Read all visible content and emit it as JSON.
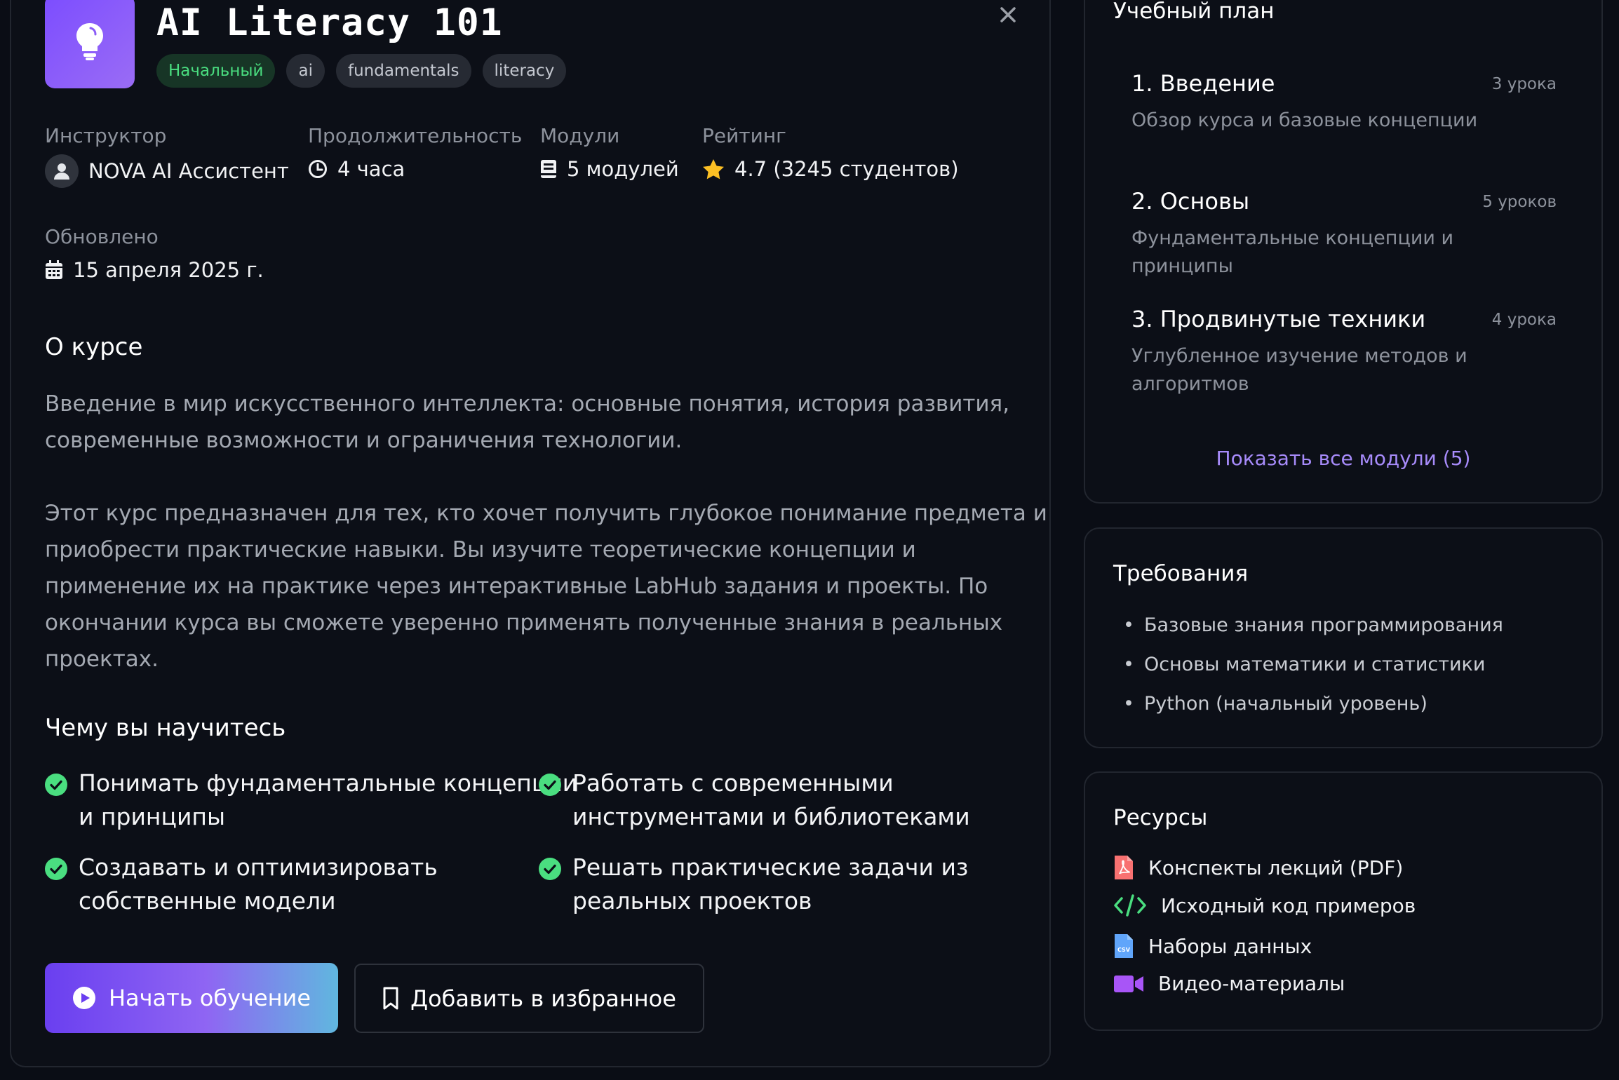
{
  "course": {
    "title": "AI Literacy 101",
    "tags": [
      "Начальный",
      "ai",
      "fundamentals",
      "literacy"
    ]
  },
  "meta": {
    "instructor_label": "Инструктор",
    "instructor_value": "NOVA AI Ассистент",
    "duration_label": "Продолжительность",
    "duration_value": "4 часа",
    "modules_label": "Модули",
    "modules_value": "5 модулей",
    "rating_label": "Рейтинг",
    "rating_value": "4.7 (3245 студентов)",
    "updated_label": "Обновлено",
    "updated_value": "15 апреля 2025 г."
  },
  "about": {
    "title": "О курсе",
    "p1_line1": "Введение в мир искусственного интеллекта: основные понятия, история развития,",
    "p1_line2": "современные возможности и ограничения технологии.",
    "p2_line1": "Этот курс предназначен для тех, кто хочет получить глубокое понимание предмета и",
    "p2_line2": "приобрести практические навыки. Вы изучите теоретические концепции и",
    "p2_line3": "применение их на практике через интерактивные LabHub задания и проекты. По",
    "p2_line4": "окончании курса вы сможете уверенно применять полученные знания в реальных",
    "p2_line5": "проектах."
  },
  "learn": {
    "title": "Чему вы научитесь",
    "items": [
      {
        "line1": "Понимать фундаментальные концепции",
        "line2": "и принципы"
      },
      {
        "line1": "Работать с современными",
        "line2": "инструментами и библиотеками"
      },
      {
        "line1": "Создавать и оптимизировать",
        "line2": "собственные модели"
      },
      {
        "line1": "Решать практические задачи из",
        "line2": "реальных проектов"
      }
    ]
  },
  "actions": {
    "start": "Начать обучение",
    "favorite": "Добавить в избранное"
  },
  "curriculum": {
    "title": "Учебный план",
    "modules": [
      {
        "title": "1. Введение",
        "count": "3 урока",
        "desc1": "Обзор курса и базовые концепции",
        "desc2": ""
      },
      {
        "title": "2. Основы",
        "count": "5 уроков",
        "desc1": "Фундаментальные концепции и принципы",
        "desc2": ""
      },
      {
        "title": "3. Продвинутые техники",
        "count": "4 урока",
        "desc1": "Углубленное изучение методов и",
        "desc2": "алгоритмов"
      }
    ],
    "show_all": "Показать все модули (5)"
  },
  "requirements": {
    "title": "Требования",
    "items": [
      "Базовые знания программирования",
      "Основы математики и статистики",
      "Python (начальный уровень)"
    ]
  },
  "resources": {
    "title": "Ресурсы",
    "items": [
      {
        "label": "Конспекты лекций (PDF)",
        "icon": "pdf-icon"
      },
      {
        "label": "Исходный код примеров",
        "icon": "code-icon"
      },
      {
        "label": "Наборы данных",
        "icon": "csv-file-icon"
      },
      {
        "label": "Видео-материалы",
        "icon": "video-icon"
      }
    ]
  },
  "colors": {
    "accent": "#7c4dff",
    "link": "#a78bfa",
    "success": "#4ade80",
    "star": "#fbbf24"
  }
}
